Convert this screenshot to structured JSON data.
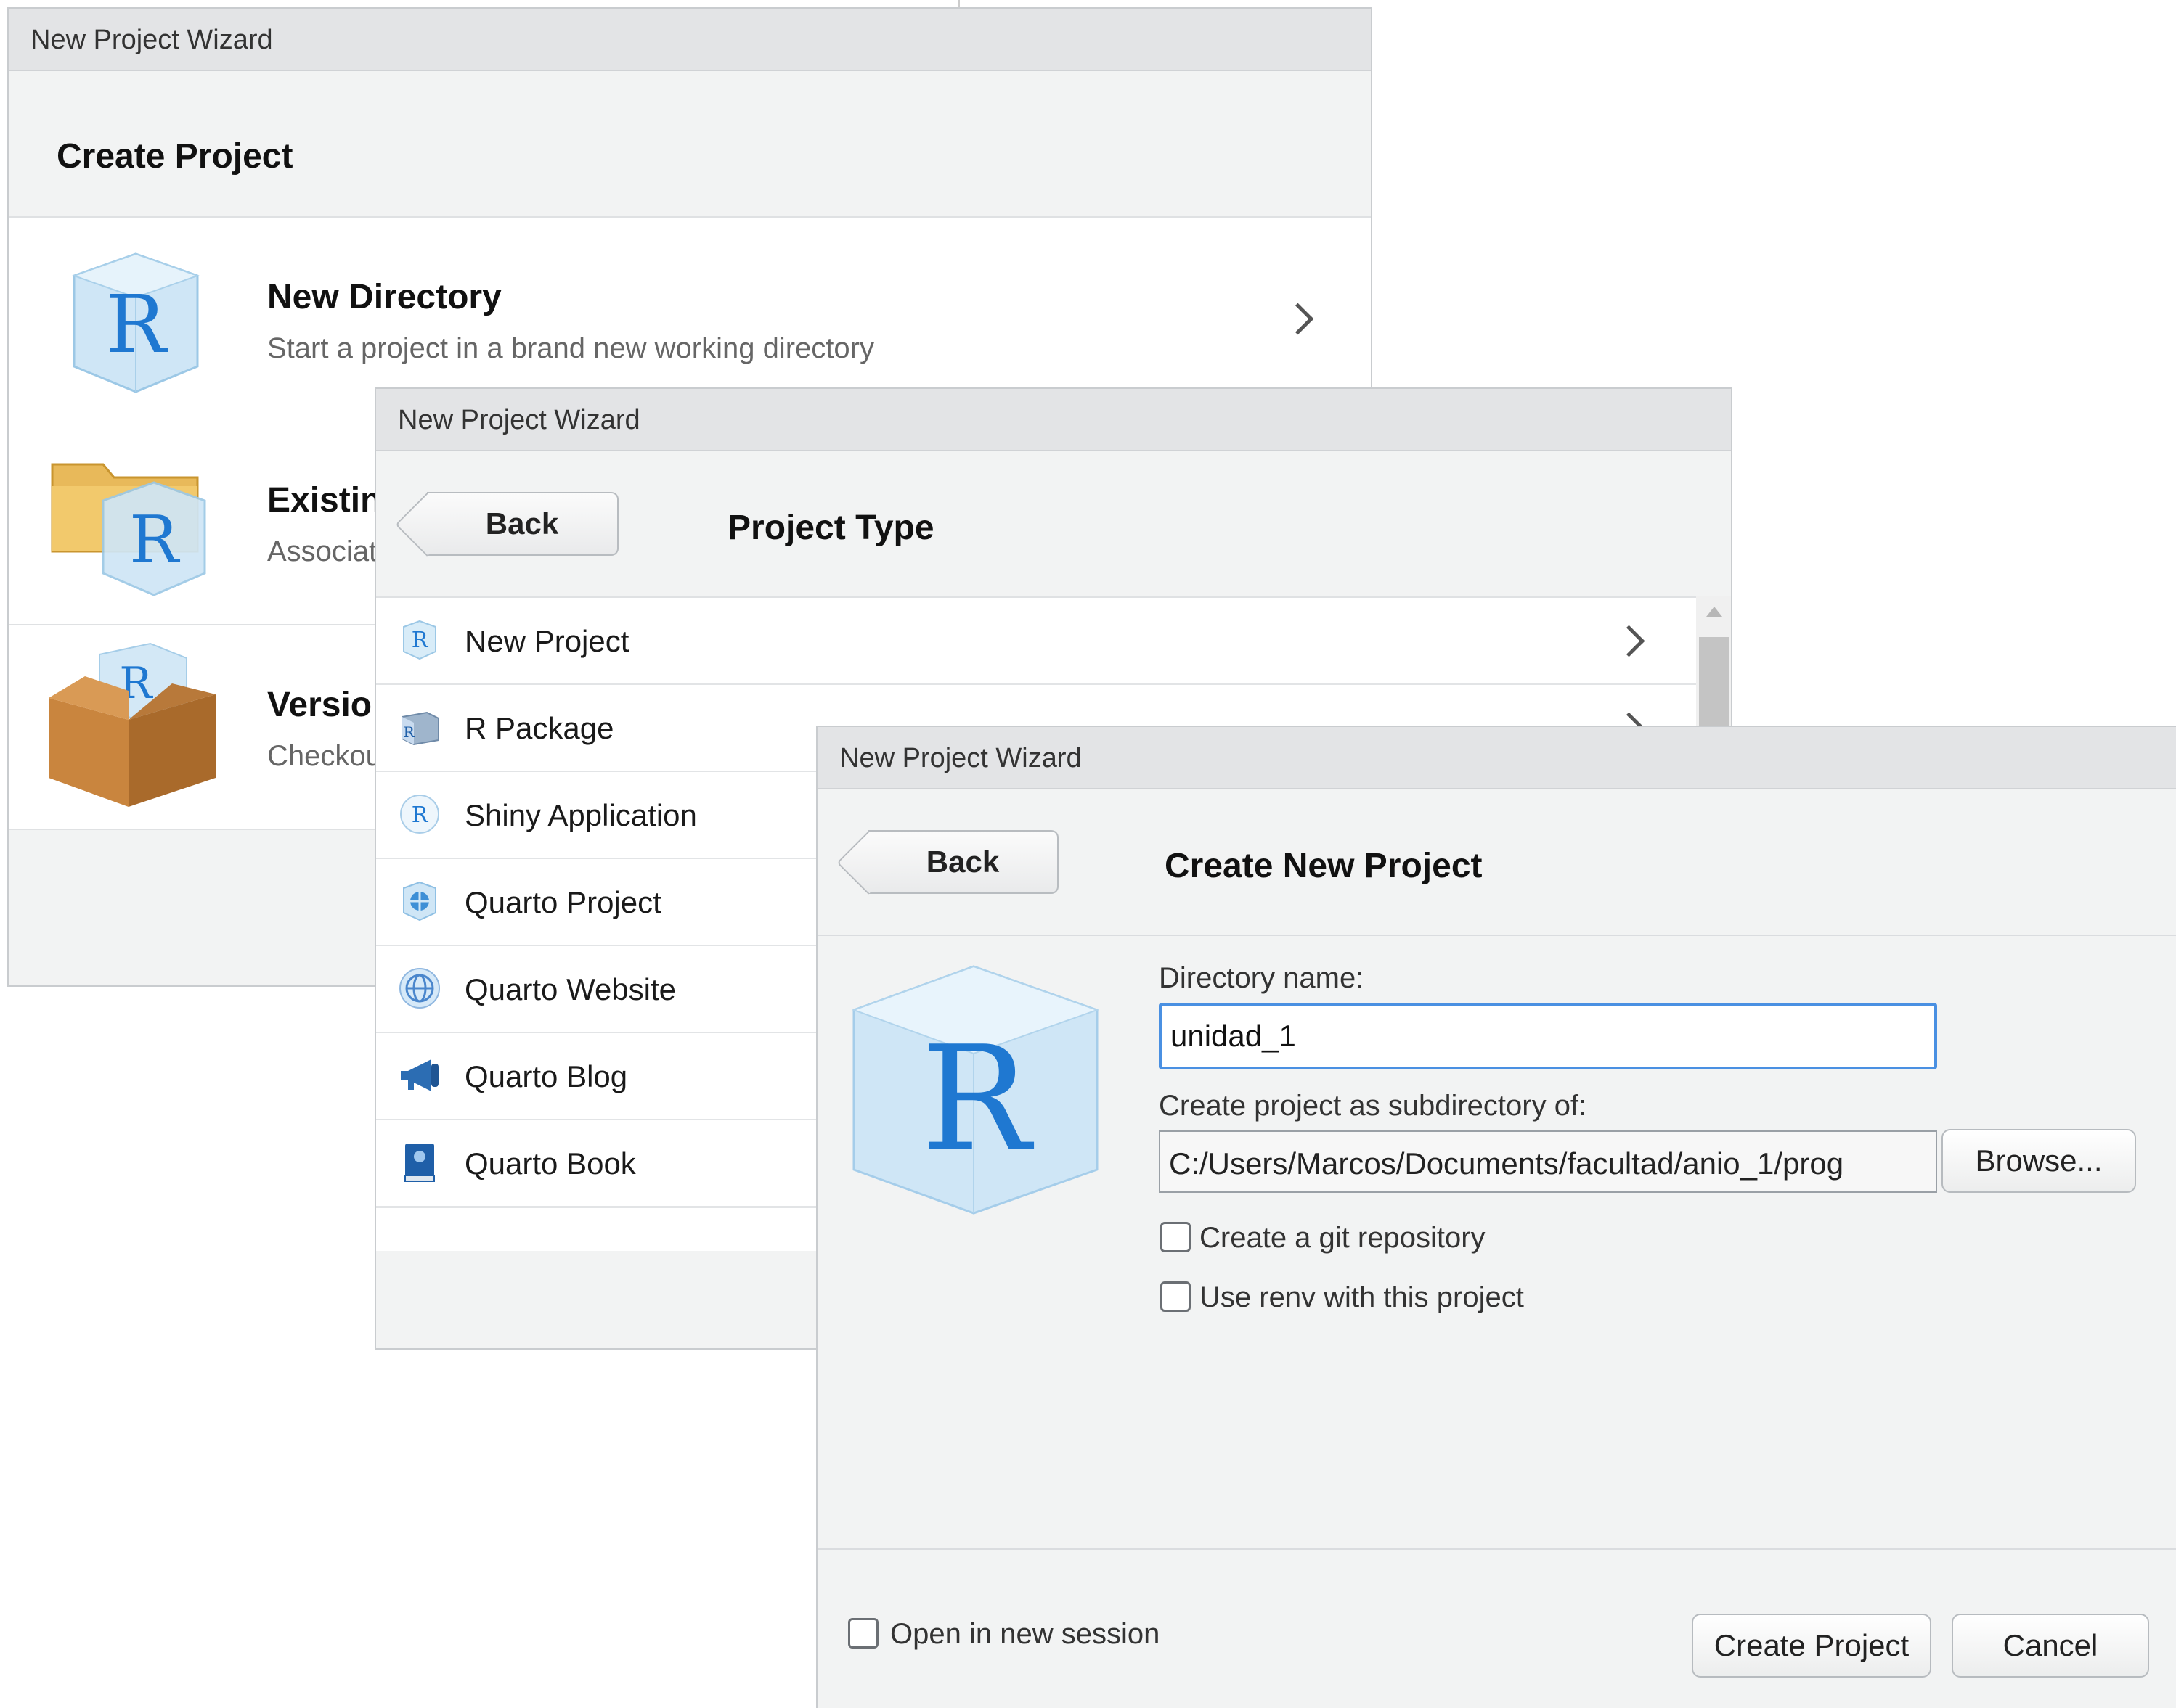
{
  "window1": {
    "title": "New Project Wizard",
    "header": "Create Project",
    "options": [
      {
        "title": "New Directory",
        "desc": "Start a project in a brand new working directory",
        "icon": "r-cube-icon"
      },
      {
        "title": "Existin",
        "desc": "Associat",
        "icon": "folder-r-icon"
      },
      {
        "title": "Versio",
        "desc": "Checkou",
        "icon": "box-r-icon"
      }
    ]
  },
  "window2": {
    "title": "New Project Wizard",
    "back_label": "Back",
    "header": "Project Type",
    "items": [
      {
        "label": "New Project",
        "icon": "r-cube-small-icon"
      },
      {
        "label": "R Package",
        "icon": "r-package-icon"
      },
      {
        "label": "Shiny Application",
        "icon": "shiny-icon"
      },
      {
        "label": "Quarto Project",
        "icon": "quarto-project-icon"
      },
      {
        "label": "Quarto Website",
        "icon": "globe-icon"
      },
      {
        "label": "Quarto Blog",
        "icon": "megaphone-icon"
      },
      {
        "label": "Quarto Book",
        "icon": "book-icon"
      }
    ]
  },
  "window3": {
    "title": "New Project Wizard",
    "back_label": "Back",
    "header": "Create New Project",
    "dir_label": "Directory name:",
    "dir_value": "unidad_1",
    "subdir_label": "Create project as subdirectory of:",
    "subdir_value": "C:/Users/Marcos/Documents/facultad/anio_1/prog",
    "browse_label": "Browse...",
    "git_label": "Create a git repository",
    "renv_label": "Use renv with this project",
    "new_session_label": "Open in new session",
    "create_label": "Create Project",
    "cancel_label": "Cancel"
  },
  "colors": {
    "accent": "#4a90e2",
    "r_blue": "#1f6fc4"
  }
}
